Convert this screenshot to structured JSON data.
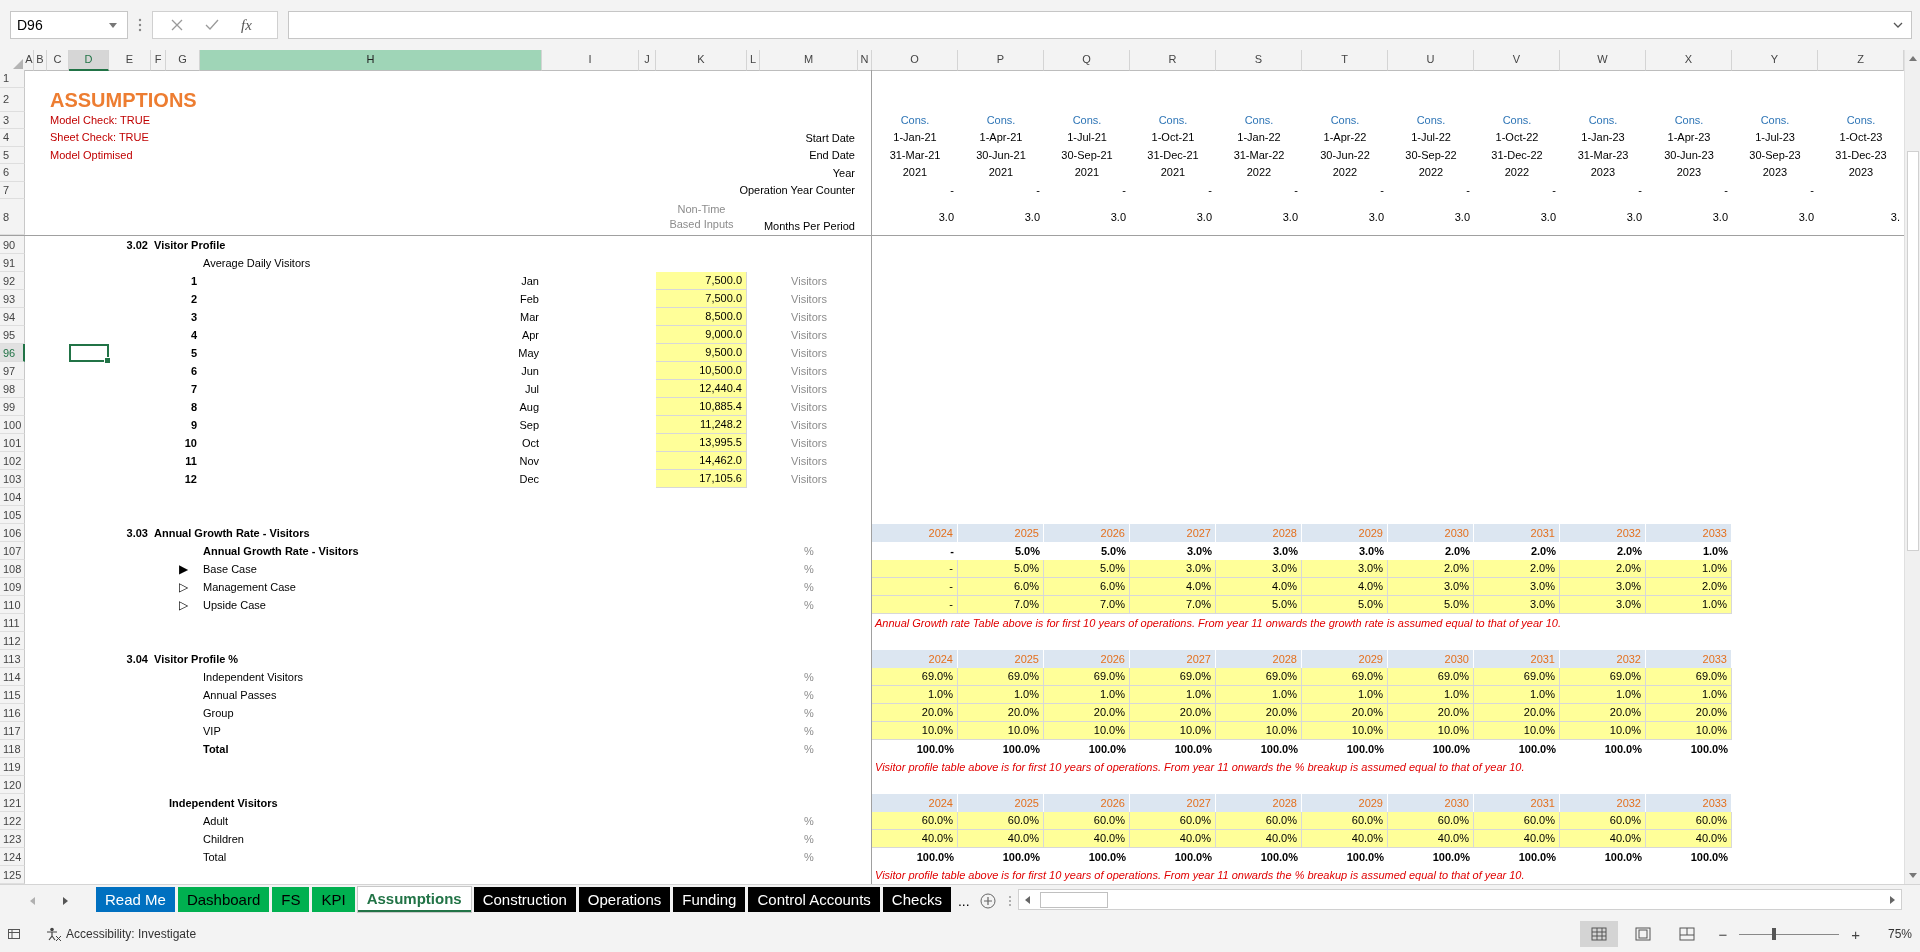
{
  "formula_bar": {
    "name_box": "D96",
    "function_label": "fx"
  },
  "columns": [
    {
      "label": "A",
      "selected": false,
      "highlighted": false
    },
    {
      "label": "B",
      "selected": false,
      "highlighted": false
    },
    {
      "label": "C",
      "selected": false,
      "highlighted": false
    },
    {
      "label": "D",
      "selected": true,
      "highlighted": false
    },
    {
      "label": "E",
      "selected": false,
      "highlighted": false
    },
    {
      "label": "F",
      "selected": false,
      "highlighted": false
    },
    {
      "label": "G",
      "selected": false,
      "highlighted": false
    },
    {
      "label": "H",
      "selected": false,
      "highlighted": true
    },
    {
      "label": "I",
      "selected": false,
      "highlighted": false
    },
    {
      "label": "J",
      "selected": false,
      "highlighted": false
    },
    {
      "label": "K",
      "selected": false,
      "highlighted": false
    },
    {
      "label": "L",
      "selected": false,
      "highlighted": false
    },
    {
      "label": "M",
      "selected": false,
      "highlighted": false
    },
    {
      "label": "N",
      "selected": false,
      "highlighted": false
    },
    {
      "label": "O",
      "selected": false,
      "highlighted": false
    },
    {
      "label": "P",
      "selected": false,
      "highlighted": false
    },
    {
      "label": "Q",
      "selected": false,
      "highlighted": false
    },
    {
      "label": "R",
      "selected": false,
      "highlighted": false
    },
    {
      "label": "S",
      "selected": false,
      "highlighted": false
    },
    {
      "label": "T",
      "selected": false,
      "highlighted": false
    },
    {
      "label": "U",
      "selected": false,
      "highlighted": false
    },
    {
      "label": "V",
      "selected": false,
      "highlighted": false
    },
    {
      "label": "W",
      "selected": false,
      "highlighted": false
    },
    {
      "label": "X",
      "selected": false,
      "highlighted": false
    },
    {
      "label": "Y",
      "selected": false,
      "highlighted": false
    },
    {
      "label": "Z",
      "selected": false,
      "highlighted": false
    }
  ],
  "frozen_rows": [
    {
      "number": "1",
      "selected": false
    },
    {
      "number": "2",
      "selected": false,
      "cells": {
        "C": {
          "kind": "title",
          "text": "ASSUMPTIONS"
        }
      }
    },
    {
      "number": "3",
      "selected": false,
      "cells": {
        "C": {
          "kind": "check",
          "text": "Model Check: TRUE"
        }
      },
      "band": {
        "kind": "cons",
        "values": [
          "Cons.",
          "Cons.",
          "Cons.",
          "Cons.",
          "Cons.",
          "Cons.",
          "Cons.",
          "Cons.",
          "Cons.",
          "Cons.",
          "Cons.",
          "Cons."
        ]
      }
    },
    {
      "number": "4",
      "selected": false,
      "cells": {
        "C": {
          "kind": "check",
          "text": "Sheet Check: TRUE"
        },
        "M": {
          "kind": "label_right",
          "text": "Start Date"
        }
      },
      "band": {
        "kind": "date",
        "values": [
          "1-Jan-21",
          "1-Apr-21",
          "1-Jul-21",
          "1-Oct-21",
          "1-Jan-22",
          "1-Apr-22",
          "1-Jul-22",
          "1-Oct-22",
          "1-Jan-23",
          "1-Apr-23",
          "1-Jul-23",
          "1-Oct-23"
        ]
      }
    },
    {
      "number": "5",
      "selected": false,
      "cells": {
        "C": {
          "kind": "check",
          "text": "Model Optimised"
        },
        "M": {
          "kind": "label_right",
          "text": "End Date"
        }
      },
      "band": {
        "kind": "date",
        "values": [
          "31-Mar-21",
          "30-Jun-21",
          "30-Sep-21",
          "31-Dec-21",
          "31-Mar-22",
          "30-Jun-22",
          "30-Sep-22",
          "31-Dec-22",
          "31-Mar-23",
          "30-Jun-23",
          "30-Sep-23",
          "31-Dec-23"
        ]
      }
    },
    {
      "number": "6",
      "selected": false,
      "cells": {
        "M": {
          "kind": "label_right",
          "text": "Year"
        }
      },
      "band": {
        "kind": "date",
        "values": [
          "2021",
          "2021",
          "2021",
          "2021",
          "2022",
          "2022",
          "2022",
          "2022",
          "2023",
          "2023",
          "2023",
          "2023"
        ]
      }
    },
    {
      "number": "7",
      "selected": false,
      "cells": {
        "M": {
          "kind": "label_right",
          "text": "Operation Year Counter"
        }
      },
      "band": {
        "kind": "value",
        "values": [
          "-",
          "-",
          "-",
          "-",
          "-",
          "-",
          "-",
          "-",
          "-",
          "-",
          "-"
        ]
      }
    },
    {
      "number": "8",
      "selected": false,
      "cells": {
        "K": {
          "kind": "hint",
          "text": "Non-Time Based Inputs"
        },
        "M": {
          "kind": "label_right",
          "text": "Months Per Period"
        }
      },
      "band": {
        "kind": "value",
        "values": [
          "3.0",
          "3.0",
          "3.0",
          "3.0",
          "3.0",
          "3.0",
          "3.0",
          "3.0",
          "3.0",
          "3.0",
          "3.0",
          "3."
        ]
      }
    }
  ],
  "rows": [
    {
      "number": "90",
      "selected": false,
      "cells": {
        "E": {
          "kind": "heading_right",
          "text": "3.02"
        },
        "F": {
          "kind": "heading",
          "text": "Visitor Profile"
        }
      }
    },
    {
      "number": "91",
      "selected": false,
      "cells": {
        "H": {
          "kind": "label",
          "text": "Average Daily Visitors"
        }
      }
    },
    {
      "number": "92",
      "selected": false,
      "cells": {
        "G": {
          "kind": "heading_right",
          "text": "1"
        },
        "H": {
          "kind": "label_right",
          "text": "Jan"
        },
        "K": {
          "kind": "input",
          "text": "7,500.0"
        },
        "M": {
          "kind": "unit",
          "text": "Visitors"
        }
      }
    },
    {
      "number": "93",
      "selected": false,
      "cells": {
        "G": {
          "kind": "heading_right",
          "text": "2"
        },
        "H": {
          "kind": "label_right",
          "text": "Feb"
        },
        "K": {
          "kind": "input",
          "text": "7,500.0"
        },
        "M": {
          "kind": "unit",
          "text": "Visitors"
        }
      }
    },
    {
      "number": "94",
      "selected": false,
      "cells": {
        "G": {
          "kind": "heading_right",
          "text": "3"
        },
        "H": {
          "kind": "label_right",
          "text": "Mar"
        },
        "K": {
          "kind": "input",
          "text": "8,500.0"
        },
        "M": {
          "kind": "unit",
          "text": "Visitors"
        }
      }
    },
    {
      "number": "95",
      "selected": false,
      "cells": {
        "G": {
          "kind": "heading_right",
          "text": "4"
        },
        "H": {
          "kind": "label_right",
          "text": "Apr"
        },
        "K": {
          "kind": "input",
          "text": "9,000.0"
        },
        "M": {
          "kind": "unit",
          "text": "Visitors"
        }
      }
    },
    {
      "number": "96",
      "selected": true,
      "cells": {
        "G": {
          "kind": "heading_right",
          "text": "5"
        },
        "H": {
          "kind": "label_right",
          "text": "May"
        },
        "K": {
          "kind": "input",
          "text": "9,500.0"
        },
        "M": {
          "kind": "unit",
          "text": "Visitors"
        }
      }
    },
    {
      "number": "97",
      "selected": false,
      "cells": {
        "G": {
          "kind": "heading_right",
          "text": "6"
        },
        "H": {
          "kind": "label_right",
          "text": "Jun"
        },
        "K": {
          "kind": "input",
          "text": "10,500.0"
        },
        "M": {
          "kind": "unit",
          "text": "Visitors"
        }
      }
    },
    {
      "number": "98",
      "selected": false,
      "cells": {
        "G": {
          "kind": "heading_right",
          "text": "7"
        },
        "H": {
          "kind": "label_right",
          "text": "Jul"
        },
        "K": {
          "kind": "input",
          "text": "12,440.4"
        },
        "M": {
          "kind": "unit",
          "text": "Visitors"
        }
      }
    },
    {
      "number": "99",
      "selected": false,
      "cells": {
        "G": {
          "kind": "heading_right",
          "text": "8"
        },
        "H": {
          "kind": "label_right",
          "text": "Aug"
        },
        "K": {
          "kind": "input",
          "text": "10,885.4"
        },
        "M": {
          "kind": "unit",
          "text": "Visitors"
        }
      }
    },
    {
      "number": "100",
      "selected": false,
      "cells": {
        "G": {
          "kind": "heading_right",
          "text": "9"
        },
        "H": {
          "kind": "label_right",
          "text": "Sep"
        },
        "K": {
          "kind": "input",
          "text": "11,248.2"
        },
        "M": {
          "kind": "unit",
          "text": "Visitors"
        }
      }
    },
    {
      "number": "101",
      "selected": false,
      "cells": {
        "G": {
          "kind": "heading_right",
          "text": "10"
        },
        "H": {
          "kind": "label_right",
          "text": "Oct"
        },
        "K": {
          "kind": "input",
          "text": "13,995.5"
        },
        "M": {
          "kind": "unit",
          "text": "Visitors"
        }
      }
    },
    {
      "number": "102",
      "selected": false,
      "cells": {
        "G": {
          "kind": "heading_right",
          "text": "11"
        },
        "H": {
          "kind": "label_right",
          "text": "Nov"
        },
        "K": {
          "kind": "input",
          "text": "14,462.0"
        },
        "M": {
          "kind": "unit",
          "text": "Visitors"
        }
      }
    },
    {
      "number": "103",
      "selected": false,
      "cells": {
        "G": {
          "kind": "heading_right",
          "text": "12"
        },
        "H": {
          "kind": "label_right",
          "text": "Dec"
        },
        "K": {
          "kind": "input",
          "text": "17,105.6"
        },
        "M": {
          "kind": "unit",
          "text": "Visitors"
        }
      }
    },
    {
      "number": "104",
      "selected": false
    },
    {
      "number": "105",
      "selected": false
    },
    {
      "number": "106",
      "selected": false,
      "cells": {
        "E": {
          "kind": "heading_right",
          "text": "3.03"
        },
        "F": {
          "kind": "heading",
          "text": "Annual Growth Rate - Visitors"
        }
      },
      "band": {
        "kind": "year",
        "values": [
          "2024",
          "2025",
          "2026",
          "2027",
          "2028",
          "2029",
          "2030",
          "2031",
          "2032",
          "2033"
        ]
      }
    },
    {
      "number": "107",
      "selected": false,
      "cells": {
        "H": {
          "kind": "heading",
          "text": "Annual Growth Rate - Visitors"
        },
        "M": {
          "kind": "unit",
          "text": "%"
        }
      },
      "band": {
        "kind": "value_bold",
        "values": [
          "-",
          "5.0%",
          "5.0%",
          "3.0%",
          "3.0%",
          "3.0%",
          "2.0%",
          "2.0%",
          "2.0%",
          "1.0%"
        ]
      }
    },
    {
      "number": "108",
      "selected": false,
      "cells": {
        "G": {
          "kind": "marker",
          "text": "▶"
        },
        "H": {
          "kind": "label",
          "text": "Base Case"
        },
        "M": {
          "kind": "unit",
          "text": "%"
        }
      },
      "band": {
        "kind": "input",
        "values": [
          "-",
          "5.0%",
          "5.0%",
          "3.0%",
          "3.0%",
          "3.0%",
          "2.0%",
          "2.0%",
          "2.0%",
          "1.0%"
        ]
      }
    },
    {
      "number": "109",
      "selected": false,
      "cells": {
        "G": {
          "kind": "marker",
          "text": "▷"
        },
        "H": {
          "kind": "label",
          "text": "Management Case"
        },
        "M": {
          "kind": "unit",
          "text": "%"
        }
      },
      "band": {
        "kind": "input",
        "values": [
          "-",
          "6.0%",
          "6.0%",
          "4.0%",
          "4.0%",
          "4.0%",
          "3.0%",
          "3.0%",
          "3.0%",
          "2.0%"
        ]
      }
    },
    {
      "number": "110",
      "selected": false,
      "cells": {
        "G": {
          "kind": "marker",
          "text": "▷"
        },
        "H": {
          "kind": "label",
          "text": "Upside Case"
        },
        "M": {
          "kind": "unit",
          "text": "%"
        }
      },
      "band": {
        "kind": "input",
        "values": [
          "-",
          "7.0%",
          "7.0%",
          "7.0%",
          "5.0%",
          "5.0%",
          "5.0%",
          "3.0%",
          "3.0%",
          "1.0%"
        ]
      }
    },
    {
      "number": "111",
      "selected": false,
      "cells": {
        "O": {
          "kind": "note",
          "text": "Annual Growth rate Table above is for first 10 years of operations. From year 11 onwards the growth rate is assumed equal to that of year 10."
        }
      }
    },
    {
      "number": "112",
      "selected": false
    },
    {
      "number": "113",
      "selected": false,
      "cells": {
        "E": {
          "kind": "heading_right",
          "text": "3.04"
        },
        "F": {
          "kind": "heading",
          "text": "Visitor Profile %"
        }
      },
      "band": {
        "kind": "year",
        "values": [
          "2024",
          "2025",
          "2026",
          "2027",
          "2028",
          "2029",
          "2030",
          "2031",
          "2032",
          "2033"
        ]
      }
    },
    {
      "number": "114",
      "selected": false,
      "cells": {
        "H": {
          "kind": "label",
          "text": "Independent Visitors"
        },
        "M": {
          "kind": "unit",
          "text": "%"
        }
      },
      "band": {
        "kind": "input",
        "values": [
          "69.0%",
          "69.0%",
          "69.0%",
          "69.0%",
          "69.0%",
          "69.0%",
          "69.0%",
          "69.0%",
          "69.0%",
          "69.0%"
        ]
      }
    },
    {
      "number": "115",
      "selected": false,
      "cells": {
        "H": {
          "kind": "label",
          "text": "Annual Passes"
        },
        "M": {
          "kind": "unit",
          "text": "%"
        }
      },
      "band": {
        "kind": "input",
        "values": [
          "1.0%",
          "1.0%",
          "1.0%",
          "1.0%",
          "1.0%",
          "1.0%",
          "1.0%",
          "1.0%",
          "1.0%",
          "1.0%"
        ]
      }
    },
    {
      "number": "116",
      "selected": false,
      "cells": {
        "H": {
          "kind": "label",
          "text": "Group"
        },
        "M": {
          "kind": "unit",
          "text": "%"
        }
      },
      "band": {
        "kind": "input",
        "values": [
          "20.0%",
          "20.0%",
          "20.0%",
          "20.0%",
          "20.0%",
          "20.0%",
          "20.0%",
          "20.0%",
          "20.0%",
          "20.0%"
        ]
      }
    },
    {
      "number": "117",
      "selected": false,
      "cells": {
        "H": {
          "kind": "label",
          "text": "VIP"
        },
        "M": {
          "kind": "unit",
          "text": "%"
        }
      },
      "band": {
        "kind": "input",
        "values": [
          "10.0%",
          "10.0%",
          "10.0%",
          "10.0%",
          "10.0%",
          "10.0%",
          "10.0%",
          "10.0%",
          "10.0%",
          "10.0%"
        ]
      }
    },
    {
      "number": "118",
      "selected": false,
      "cells": {
        "H": {
          "kind": "heading",
          "text": "Total"
        },
        "M": {
          "kind": "unit",
          "text": "%"
        }
      },
      "band": {
        "kind": "value_bold",
        "values": [
          "100.0%",
          "100.0%",
          "100.0%",
          "100.0%",
          "100.0%",
          "100.0%",
          "100.0%",
          "100.0%",
          "100.0%",
          "100.0%"
        ]
      }
    },
    {
      "number": "119",
      "selected": false,
      "cells": {
        "O": {
          "kind": "note",
          "text": "Visitor profile table above is for first 10 years of operations. From year 11 onwards the % breakup is assumed equal to that of year 10."
        }
      }
    },
    {
      "number": "120",
      "selected": false
    },
    {
      "number": "121",
      "selected": false,
      "cells": {
        "G": {
          "kind": "heading",
          "text": "Independent Visitors"
        }
      },
      "band": {
        "kind": "year",
        "values": [
          "2024",
          "2025",
          "2026",
          "2027",
          "2028",
          "2029",
          "2030",
          "2031",
          "2032",
          "2033"
        ]
      }
    },
    {
      "number": "122",
      "selected": false,
      "cells": {
        "H": {
          "kind": "label",
          "text": "Adult"
        },
        "M": {
          "kind": "unit",
          "text": "%"
        }
      },
      "band": {
        "kind": "input",
        "values": [
          "60.0%",
          "60.0%",
          "60.0%",
          "60.0%",
          "60.0%",
          "60.0%",
          "60.0%",
          "60.0%",
          "60.0%",
          "60.0%"
        ]
      }
    },
    {
      "number": "123",
      "selected": false,
      "cells": {
        "H": {
          "kind": "label",
          "text": "Children"
        },
        "M": {
          "kind": "unit",
          "text": "%"
        }
      },
      "band": {
        "kind": "input",
        "values": [
          "40.0%",
          "40.0%",
          "40.0%",
          "40.0%",
          "40.0%",
          "40.0%",
          "40.0%",
          "40.0%",
          "40.0%",
          "40.0%"
        ]
      }
    },
    {
      "number": "124",
      "selected": false,
      "cells": {
        "H": {
          "kind": "label",
          "text": "Total"
        },
        "M": {
          "kind": "unit",
          "text": "%"
        }
      },
      "band": {
        "kind": "value_bold",
        "values": [
          "100.0%",
          "100.0%",
          "100.0%",
          "100.0%",
          "100.0%",
          "100.0%",
          "100.0%",
          "100.0%",
          "100.0%",
          "100.0%"
        ]
      }
    },
    {
      "number": "125",
      "selected": false,
      "cells": {
        "O": {
          "kind": "note",
          "text": "Visitor profile table above is for first 10 years of operations. From year 11 onwards the % breakup is assumed equal to that of year 10."
        }
      }
    }
  ],
  "sheet_tabs": [
    {
      "label": "Read Me",
      "selected": false,
      "color": "#0070c0"
    },
    {
      "label": "Dashboard",
      "selected": false,
      "color": "#00b050"
    },
    {
      "label": "FS",
      "selected": false,
      "color": "#00b050"
    },
    {
      "label": "KPI",
      "selected": false,
      "color": "#00b050"
    },
    {
      "label": "Assumptions",
      "selected": true
    },
    {
      "label": "Construction",
      "selected": false,
      "color": "#000000"
    },
    {
      "label": "Operations",
      "selected": false,
      "color": "#000000"
    },
    {
      "label": "Funding",
      "selected": false,
      "color": "#000000"
    },
    {
      "label": "Control Accounts",
      "selected": false,
      "color": "#000000"
    },
    {
      "label": "Checks",
      "selected": false,
      "color": "#000000"
    }
  ],
  "more_tabs": "...",
  "status_bar": {
    "accessibility": "Accessibility: Investigate",
    "views": [
      {
        "kind": "normal",
        "selected": true
      },
      {
        "kind": "page_layout",
        "selected": false
      },
      {
        "kind": "page_break",
        "selected": false
      }
    ],
    "zoom_out": "−",
    "zoom_slider": {
      "level": 0.35
    },
    "zoom_in": "+",
    "zoom": "75%"
  }
}
